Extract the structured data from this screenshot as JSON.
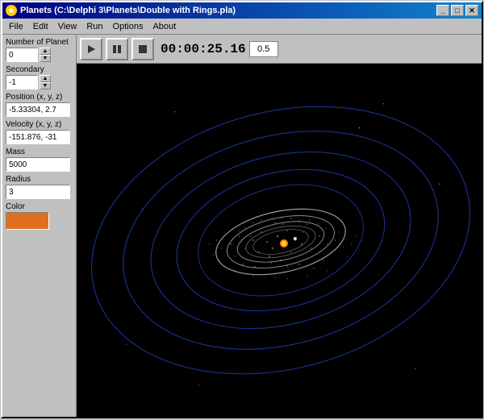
{
  "window": {
    "title": "Planets (C:\\Delphi 3\\Planets\\Double with Rings.pla)",
    "icon": "★"
  },
  "title_controls": {
    "minimize": "_",
    "maximize": "□",
    "close": "✕"
  },
  "menu": {
    "items": [
      "File",
      "Edit",
      "View",
      "Run",
      "Options",
      "About"
    ]
  },
  "left_panel": {
    "planet_label": "Number of Planet",
    "planet_value": "0",
    "secondary_label": "Secondary",
    "secondary_value": "-1",
    "position_label": "Position (x, y, z)",
    "position_value": "-5.33304, 2.7",
    "velocity_label": "Velocity (x, y, z)",
    "velocity_value": "-151.876, -31",
    "mass_label": "Mass",
    "mass_value": "5000",
    "radius_label": "Radius",
    "radius_value": "3",
    "color_label": "Color"
  },
  "toolbar": {
    "play_label": "▶",
    "pause_label": "⏸",
    "stop_label": "⏹",
    "time_display": "00:00:25.16",
    "speed_value": "0.5"
  },
  "colors": {
    "accent_orange": "#e07020",
    "orbit_blue": "#2244cc",
    "orbit_white": "#aaaaaa",
    "background": "#000000",
    "star_orange": "#ff8800",
    "star_white": "#ffffff"
  }
}
